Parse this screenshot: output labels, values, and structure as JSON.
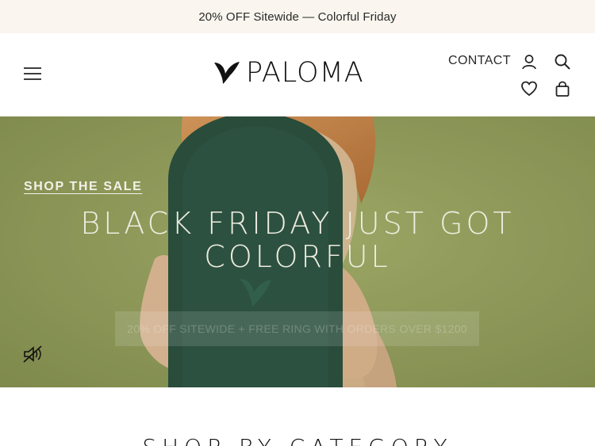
{
  "announcement": {
    "text": "20% OFF Sitewide — Colorful Friday"
  },
  "header": {
    "logo_text": "PALOMA",
    "contact_label": "CONTACT",
    "icons": [
      "menu-icon",
      "user-icon",
      "search-icon",
      "heart-icon",
      "bag-icon"
    ]
  },
  "hero": {
    "kicker": "SHOP THE SALE",
    "title_line1": "BLACK FRIDAY JUST GOT",
    "title_line2": "COLORFUL",
    "cta": "20% OFF SITEWIDE + FREE RING WITH ORDERS OVER $1200",
    "colors": {
      "background": "#8e9a5a",
      "case": "#173f38",
      "hair": "#d67b3f"
    }
  },
  "section": {
    "title": "SHOP BY CATEGORY"
  }
}
